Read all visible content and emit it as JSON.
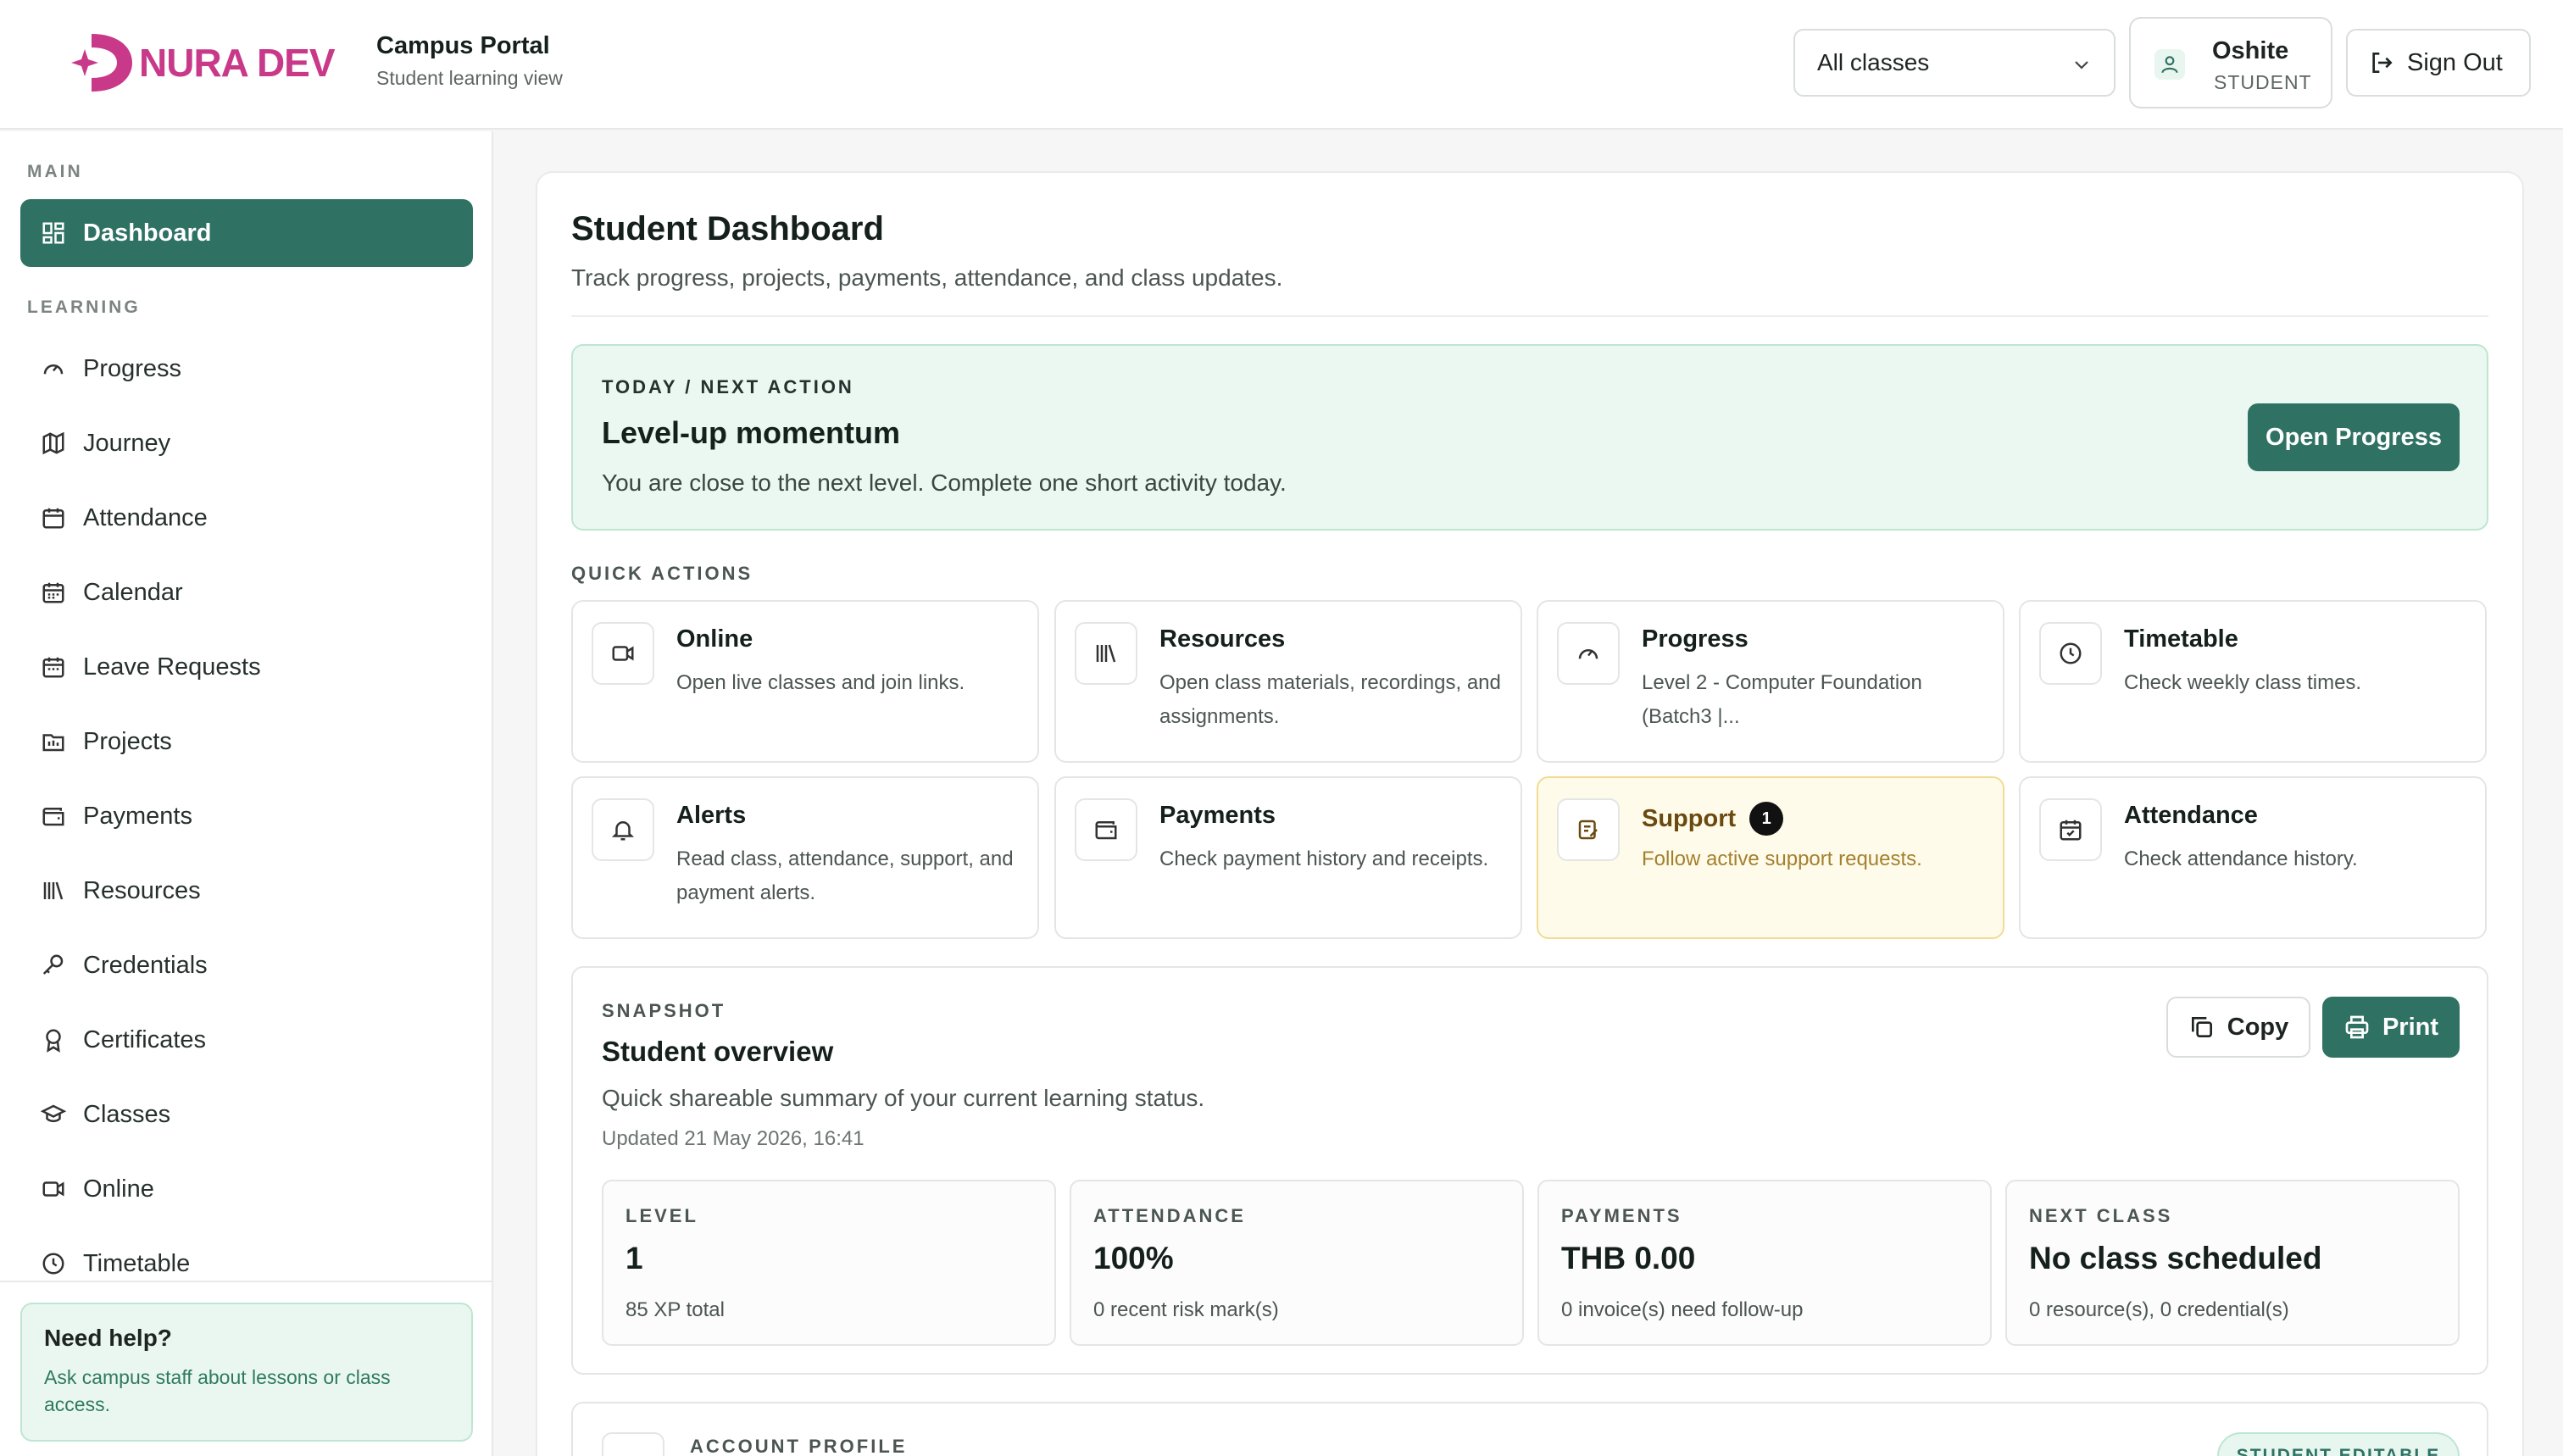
{
  "brand": {
    "logo_text": "NURA DEV",
    "accent": "#c8398a",
    "primary": "#2f7264"
  },
  "header": {
    "title": "Campus Portal",
    "subtitle": "Student learning view",
    "class_select": "All classes",
    "user_name": "Oshite",
    "user_role": "STUDENT",
    "sign_out": "Sign Out"
  },
  "sidebar": {
    "section_main": "MAIN",
    "section_learning": "LEARNING",
    "dashboard": "Dashboard",
    "items": [
      "Progress",
      "Journey",
      "Attendance",
      "Calendar",
      "Leave Requests",
      "Projects",
      "Payments",
      "Resources",
      "Credentials",
      "Certificates",
      "Classes",
      "Online",
      "Timetable"
    ],
    "help_title": "Need help?",
    "help_text": "Ask campus staff about lessons or class access."
  },
  "main": {
    "title": "Student Dashboard",
    "subtitle": "Track progress, projects, payments, attendance, and class updates.",
    "today": {
      "eyebrow": "TODAY / NEXT ACTION",
      "title": "Level-up momentum",
      "text": "You are close to the next level. Complete one short activity today.",
      "button": "Open Progress"
    },
    "quick_actions_label": "QUICK ACTIONS",
    "quick_actions": [
      {
        "title": "Online",
        "desc": "Open live classes and join links.",
        "icon": "video-icon"
      },
      {
        "title": "Resources",
        "desc": "Open class materials, recordings, and assignments.",
        "icon": "library-icon"
      },
      {
        "title": "Progress",
        "desc": "Level 2 - Computer Foundation (Batch3 |...",
        "icon": "gauge-icon"
      },
      {
        "title": "Timetable",
        "desc": "Check weekly class times.",
        "icon": "clock-icon"
      },
      {
        "title": "Alerts",
        "desc": "Read class, attendance, support, and payment alerts.",
        "icon": "bell-icon"
      },
      {
        "title": "Payments",
        "desc": "Check payment history and receipts.",
        "icon": "wallet-icon"
      },
      {
        "title": "Support",
        "desc": "Follow active support requests.",
        "icon": "ticket-icon",
        "badge": "1"
      },
      {
        "title": "Attendance",
        "desc": "Check attendance history.",
        "icon": "calendar-check-icon"
      }
    ],
    "snapshot": {
      "eyebrow": "SNAPSHOT",
      "title": "Student overview",
      "subtitle": "Quick shareable summary of your current learning status.",
      "updated": "Updated 21 May 2026, 16:41",
      "copy": "Copy",
      "print": "Print",
      "stats": [
        {
          "label": "LEVEL",
          "value": "1",
          "foot": "85 XP total"
        },
        {
          "label": "ATTENDANCE",
          "value": "100%",
          "foot": "0 recent risk mark(s)"
        },
        {
          "label": "PAYMENTS",
          "value": "THB 0.00",
          "foot": "0 invoice(s) need follow-up"
        },
        {
          "label": "NEXT CLASS",
          "value": "No class scheduled",
          "foot": "0 resource(s), 0 credential(s)"
        }
      ]
    },
    "account": {
      "eyebrow": "ACCOUNT PROFILE",
      "pill": "STUDENT EDITABLE"
    }
  }
}
